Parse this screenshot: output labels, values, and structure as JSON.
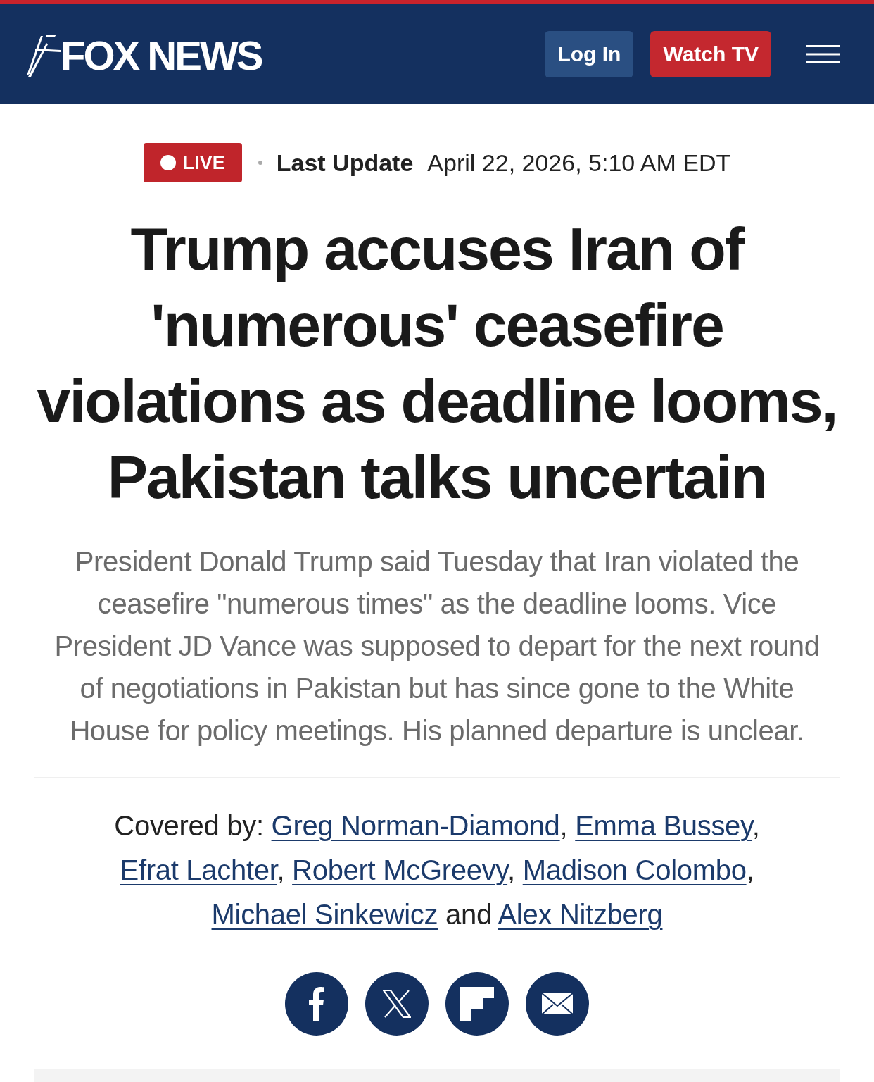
{
  "header": {
    "logo": "FOX NEWS",
    "buttons": [
      {
        "kind": "login",
        "label": "Log In"
      },
      {
        "kind": "watch",
        "label": "Watch TV"
      }
    ]
  },
  "status": {
    "live_badge": "LIVE",
    "update_label": "Last Update",
    "update_time": "April 22, 2026, 5:10 AM EDT"
  },
  "headline": "Trump accuses Iran of 'numerous' ceasefire violations as deadline looms, Pakistan talks uncertain",
  "summary": "President Donald Trump said Tuesday that Iran violated the ceasefire \"numerous times\" as the deadline looms. Vice President JD Vance was supposed to depart for the next round of negotiations in Pakistan but has since gone to the White House for policy meetings. His planned departure is unclear.",
  "byline": {
    "prefix": "Covered by:",
    "authors": [
      {
        "name": "Greg Norman-Diamond",
        "punctuation": ","
      },
      {
        "name": "Emma Bussey",
        "punctuation": ","
      },
      {
        "name": "Efrat Lachter",
        "punctuation": ","
      },
      {
        "name": "Robert McGreevy",
        "punctuation": ","
      },
      {
        "name": "Madison Colombo",
        "punctuation": ","
      },
      {
        "name": "Michael Sinkewicz"
      },
      {
        "name": "Alex Nitzberg"
      }
    ],
    "conjunction": "and"
  },
  "share_buttons": [
    {
      "kind": "facebook"
    },
    {
      "kind": "x"
    },
    {
      "kind": "flipboard"
    },
    {
      "kind": "email"
    }
  ]
}
